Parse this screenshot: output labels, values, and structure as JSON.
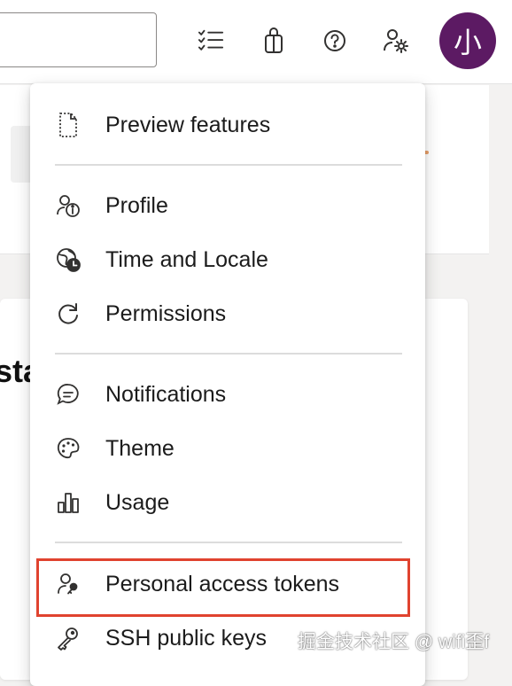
{
  "header": {
    "avatar_initial": "小",
    "icons": [
      "checklist-icon",
      "shopping-bag-icon",
      "help-icon",
      "user-settings-icon"
    ]
  },
  "background": {
    "heading_fragment": "sta"
  },
  "menu": {
    "items": [
      {
        "label": "Preview features",
        "icon": "preview-features-icon"
      },
      {
        "label": "Profile",
        "icon": "profile-icon"
      },
      {
        "label": "Time and Locale",
        "icon": "globe-clock-icon"
      },
      {
        "label": "Permissions",
        "icon": "refresh-icon"
      },
      {
        "label": "Notifications",
        "icon": "chat-bubble-icon"
      },
      {
        "label": "Theme",
        "icon": "palette-icon"
      },
      {
        "label": "Usage",
        "icon": "bar-chart-icon"
      },
      {
        "label": "Personal access tokens",
        "icon": "person-key-icon"
      },
      {
        "label": "SSH public keys",
        "icon": "ssh-key-icon"
      }
    ],
    "highlighted_item": "Personal access tokens",
    "highlight_color": "#e0432f"
  },
  "watermark": "掘金技术社区 @ wifi歪f",
  "colors": {
    "avatar_bg": "#5c1a63",
    "highlight": "#e0432f"
  }
}
